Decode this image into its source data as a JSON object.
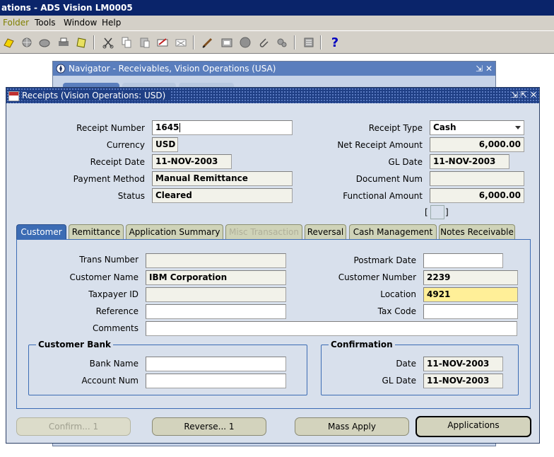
{
  "app": {
    "title": "ations - ADS Vision LM0005"
  },
  "menu": {
    "folder": "Folder",
    "tools": "Tools",
    "window": "Window",
    "help": "Help"
  },
  "toolbar": {
    "help_glyph": "?",
    "icons": [
      "open-icon",
      "navigate-icon",
      "zoom-icon",
      "print-icon",
      "save-icon",
      "cut-icon",
      "copy-icon",
      "paste-icon",
      "edit-icon",
      "clear-icon",
      "new-record-icon",
      "find-icon",
      "translations-icon",
      "attachments-icon",
      "folder-tools-icon",
      "tools-icon",
      "help-icon"
    ]
  },
  "navigator": {
    "title": "Navigator - Receivables, Vision Operations (USA)"
  },
  "receipts": {
    "title": "Receipts (Vision Operations: USD)",
    "header": {
      "receipt_number_label": "Receipt Number",
      "receipt_number": "1645",
      "currency_label": "Currency",
      "currency": "USD",
      "receipt_date_label": "Receipt Date",
      "receipt_date": "11-NOV-2003",
      "payment_method_label": "Payment Method",
      "payment_method": "Manual Remittance",
      "status_label": "Status",
      "status": "Cleared",
      "receipt_type_label": "Receipt Type",
      "receipt_type": "Cash",
      "net_receipt_amount_label": "Net Receipt Amount",
      "net_receipt_amount": "6,000.00",
      "gl_date_label": "GL Date",
      "gl_date": "11-NOV-2003",
      "document_num_label": "Document Num",
      "document_num": "",
      "functional_amount_label": "Functional Amount",
      "functional_amount": "6,000.00"
    },
    "tabs": [
      {
        "label": "Customer",
        "state": "active"
      },
      {
        "label": "Remittance",
        "state": "normal"
      },
      {
        "label": "Application Summary",
        "state": "normal"
      },
      {
        "label": "Misc Transaction",
        "state": "disabled"
      },
      {
        "label": "Reversal",
        "state": "normal"
      },
      {
        "label": "Cash Management",
        "state": "normal"
      },
      {
        "label": "Notes Receivable",
        "state": "normal"
      }
    ],
    "customer_tab": {
      "trans_number_label": "Trans Number",
      "trans_number": "",
      "customer_name_label": "Customer Name",
      "customer_name": "IBM Corporation",
      "taxpayer_id_label": "Taxpayer ID",
      "taxpayer_id": "",
      "reference_label": "Reference",
      "reference": "",
      "comments_label": "Comments",
      "comments": "",
      "postmark_date_label": "Postmark Date",
      "postmark_date": "",
      "customer_number_label": "Customer Number",
      "customer_number": "2239",
      "location_label": "Location",
      "location": "4921",
      "tax_code_label": "Tax Code",
      "tax_code": "",
      "customer_bank": {
        "title": "Customer Bank",
        "bank_name_label": "Bank Name",
        "bank_name": "",
        "account_num_label": "Account Num",
        "account_num": ""
      },
      "confirmation": {
        "title": "Confirmation",
        "date_label": "Date",
        "date": "11-NOV-2003",
        "gl_date_label": "GL Date",
        "gl_date": "11-NOV-2003"
      }
    },
    "buttons": {
      "confirm": "Confirm... 1",
      "reverse": "Reverse... 1",
      "mass_apply": "Mass Apply",
      "applications": "Applications"
    }
  },
  "colors": {
    "title_bar": "#0a246a",
    "window_title": "#1f3f85",
    "active_tab": "#3c6cb4",
    "required_field": "#ffef98"
  }
}
